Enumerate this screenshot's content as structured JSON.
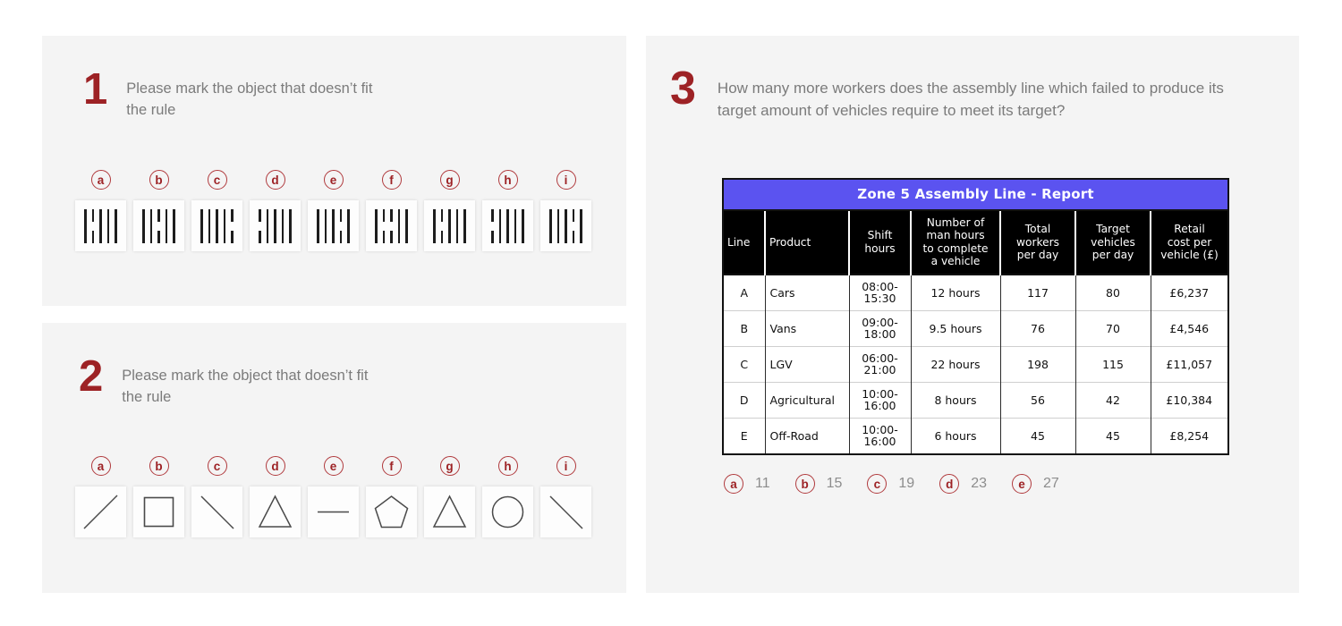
{
  "questions": [
    {
      "number": "1",
      "prompt": "Please mark the object that doesn’t fit the rule",
      "options": [
        {
          "letter": "a",
          "bars": 5,
          "split_index": 1
        },
        {
          "letter": "b",
          "bars": 5,
          "split_index": 2
        },
        {
          "letter": "c",
          "bars": 5,
          "split_index": 4
        },
        {
          "letter": "d",
          "bars": 5,
          "split_index": 0
        },
        {
          "letter": "e",
          "bars": 5,
          "split_index": 3
        },
        {
          "letter": "f",
          "bars": 5,
          "split_index": 1
        },
        {
          "letter": "g",
          "bars": 5,
          "split_index": 1
        },
        {
          "letter": "h",
          "bars": 5,
          "split_index": 0
        },
        {
          "letter": "i",
          "bars": 5,
          "split_index": 3
        }
      ]
    },
    {
      "number": "2",
      "prompt": "Please mark the object that doesn’t fit the rule",
      "options": [
        {
          "letter": "a",
          "shape": "diagonal-line-up"
        },
        {
          "letter": "b",
          "shape": "square"
        },
        {
          "letter": "c",
          "shape": "diagonal-line-down"
        },
        {
          "letter": "d",
          "shape": "triangle"
        },
        {
          "letter": "e",
          "shape": "horizontal-line"
        },
        {
          "letter": "f",
          "shape": "pentagon"
        },
        {
          "letter": "g",
          "shape": "triangle"
        },
        {
          "letter": "h",
          "shape": "circle"
        },
        {
          "letter": "i",
          "shape": "diagonal-line-down"
        }
      ]
    },
    {
      "number": "3",
      "prompt": "How many more workers does the assembly line which failed to produce its target amount of vehicles require to meet its target?",
      "options": [
        {
          "letter": "a",
          "value": "11"
        },
        {
          "letter": "b",
          "value": "15"
        },
        {
          "letter": "c",
          "value": "19"
        },
        {
          "letter": "d",
          "value": "23"
        },
        {
          "letter": "e",
          "value": "27"
        }
      ]
    }
  ],
  "report": {
    "title": "Zone 5 Assembly Line - Report",
    "columns": [
      "Line",
      "Product",
      "Shift hours",
      "Number of man hours to complete a vehicle",
      "Total workers per day",
      "Target vehicles per day",
      "Retail cost per vehicle (£)"
    ],
    "columns_lines": [
      [
        "Line"
      ],
      [
        "Product"
      ],
      [
        "Shift",
        "hours"
      ],
      [
        "Number of",
        "man hours",
        "to complete",
        "a vehicle"
      ],
      [
        "Total",
        "workers",
        "per day"
      ],
      [
        "Target",
        "vehicles",
        "per day"
      ],
      [
        "Retail",
        "cost per",
        "vehicle (£)"
      ]
    ],
    "rows": [
      {
        "line": "A",
        "product": "Cars",
        "shift_start": "08:00-",
        "shift_end": "15:30",
        "man_hours": "12 hours",
        "workers": "117",
        "target": "80",
        "cost": "£6,237"
      },
      {
        "line": "B",
        "product": "Vans",
        "shift_start": "09:00-",
        "shift_end": "18:00",
        "man_hours": "9.5 hours",
        "workers": "76",
        "target": "70",
        "cost": "£4,546"
      },
      {
        "line": "C",
        "product": "LGV",
        "shift_start": "06:00-",
        "shift_end": "21:00",
        "man_hours": "22 hours",
        "workers": "198",
        "target": "115",
        "cost": "£11,057"
      },
      {
        "line": "D",
        "product": "Agricultural",
        "shift_start": "10:00-",
        "shift_end": "16:00",
        "man_hours": "8 hours",
        "workers": "56",
        "target": "42",
        "cost": "£10,384"
      },
      {
        "line": "E",
        "product": "Off-Road",
        "shift_start": "10:00-",
        "shift_end": "16:00",
        "man_hours": "6 hours",
        "workers": "45",
        "target": "45",
        "cost": "£8,254"
      }
    ]
  },
  "colors": {
    "accent_red": "#9d2225",
    "badge_border": "#b03a3d",
    "panel_bg": "#f4f4f4",
    "text_gray": "#7b7b7b",
    "table_title_bg": "#5b53f0",
    "table_head_bg": "#000000"
  }
}
